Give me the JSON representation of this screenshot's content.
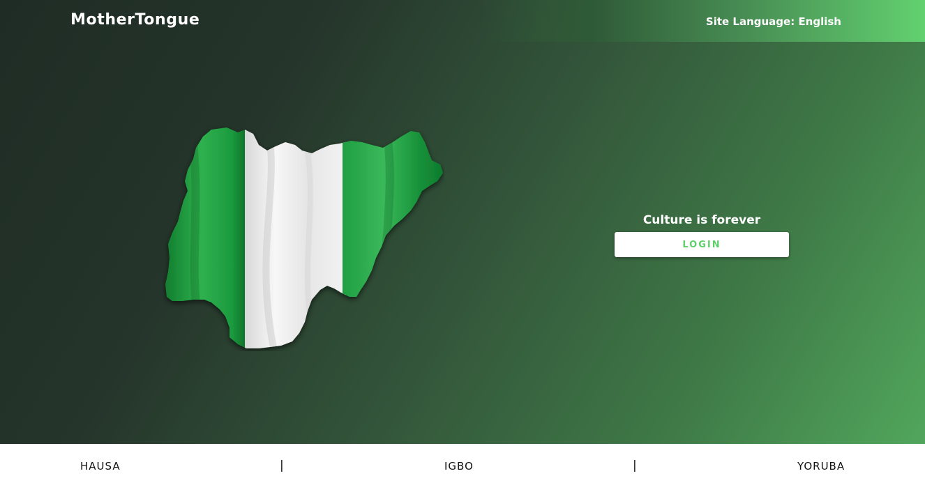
{
  "header": {
    "brand": "MotherTongue",
    "site_language_prefix": "Site Language: ",
    "site_language_value": "English"
  },
  "hero": {
    "tagline": "Culture is forever",
    "login_label": "LOGIN",
    "map_image": "nigeria-flag-map",
    "colors": {
      "flag_green": "#1a9a3e",
      "flag_white": "#f4f4f4",
      "button_text": "#5ed06a",
      "accent_green": "#62d16f"
    }
  },
  "footer": {
    "languages": [
      "HAUSA",
      "IGBO",
      "YORUBA"
    ],
    "separator": "|"
  }
}
